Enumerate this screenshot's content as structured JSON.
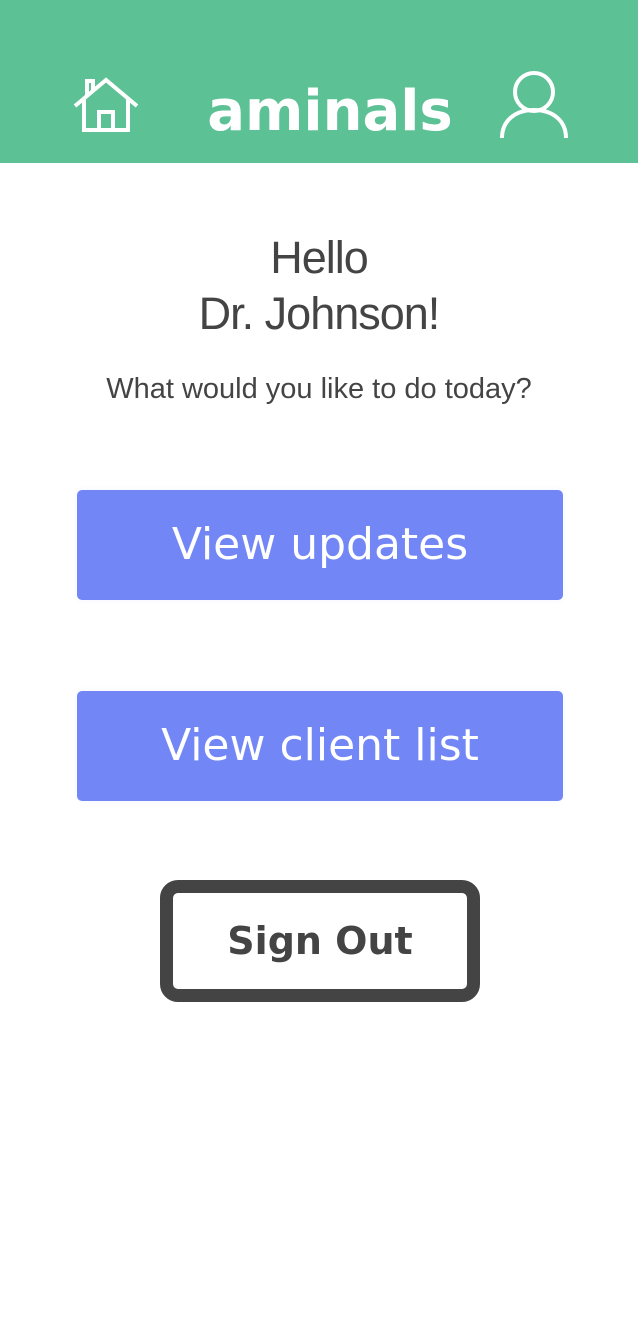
{
  "header": {
    "brand": "aminals",
    "home_icon": "home-icon",
    "user_icon": "user-icon",
    "background_color": "#5cc195"
  },
  "greeting": {
    "line1": "Hello",
    "line2": "Dr. Johnson!"
  },
  "prompt": "What would you like to do today?",
  "actions": {
    "view_updates": "View updates",
    "view_client_list": "View client list",
    "sign_out": "Sign Out",
    "primary_color": "#7287f5",
    "text_color": "#444444"
  }
}
